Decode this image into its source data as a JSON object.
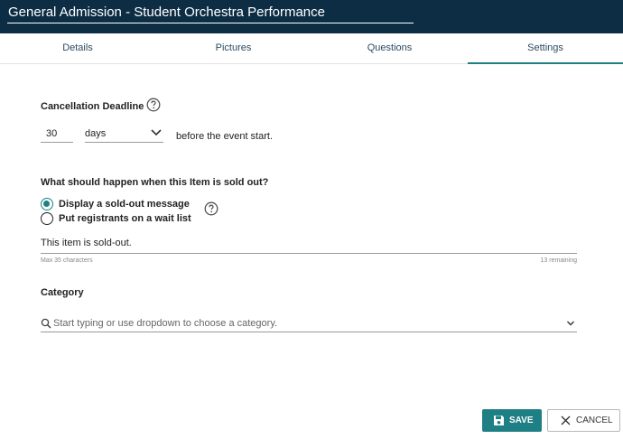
{
  "header": {
    "title": "General Admission - Student Orchestra Performance"
  },
  "tabs": [
    {
      "label": "Details"
    },
    {
      "label": "Pictures"
    },
    {
      "label": "Questions"
    },
    {
      "label": "Settings",
      "active": true
    }
  ],
  "cancellation": {
    "label": "Cancellation Deadline",
    "help_icon": "question-circle-icon",
    "amount": "30",
    "unit": "days",
    "suffix": "before the event start."
  },
  "sold_out": {
    "question": "What should happen when this Item is sold out?",
    "options": [
      {
        "label": "Display a sold-out message",
        "checked": true
      },
      {
        "label": "Put registrants on a wait list",
        "checked": false
      }
    ],
    "help_icon": "question-circle-icon",
    "message": "This item is sold-out.",
    "max_hint": "Max 35 characters",
    "remaining": "13 remaining"
  },
  "category": {
    "label": "Category",
    "placeholder": "Start typing or use dropdown to choose a category."
  },
  "actions": {
    "save_label": "SAVE",
    "cancel_label": "CANCEL"
  },
  "colors": {
    "header_bg": "#0d2d45",
    "accent": "#1e7f85",
    "tab_text": "#2b4b63"
  }
}
